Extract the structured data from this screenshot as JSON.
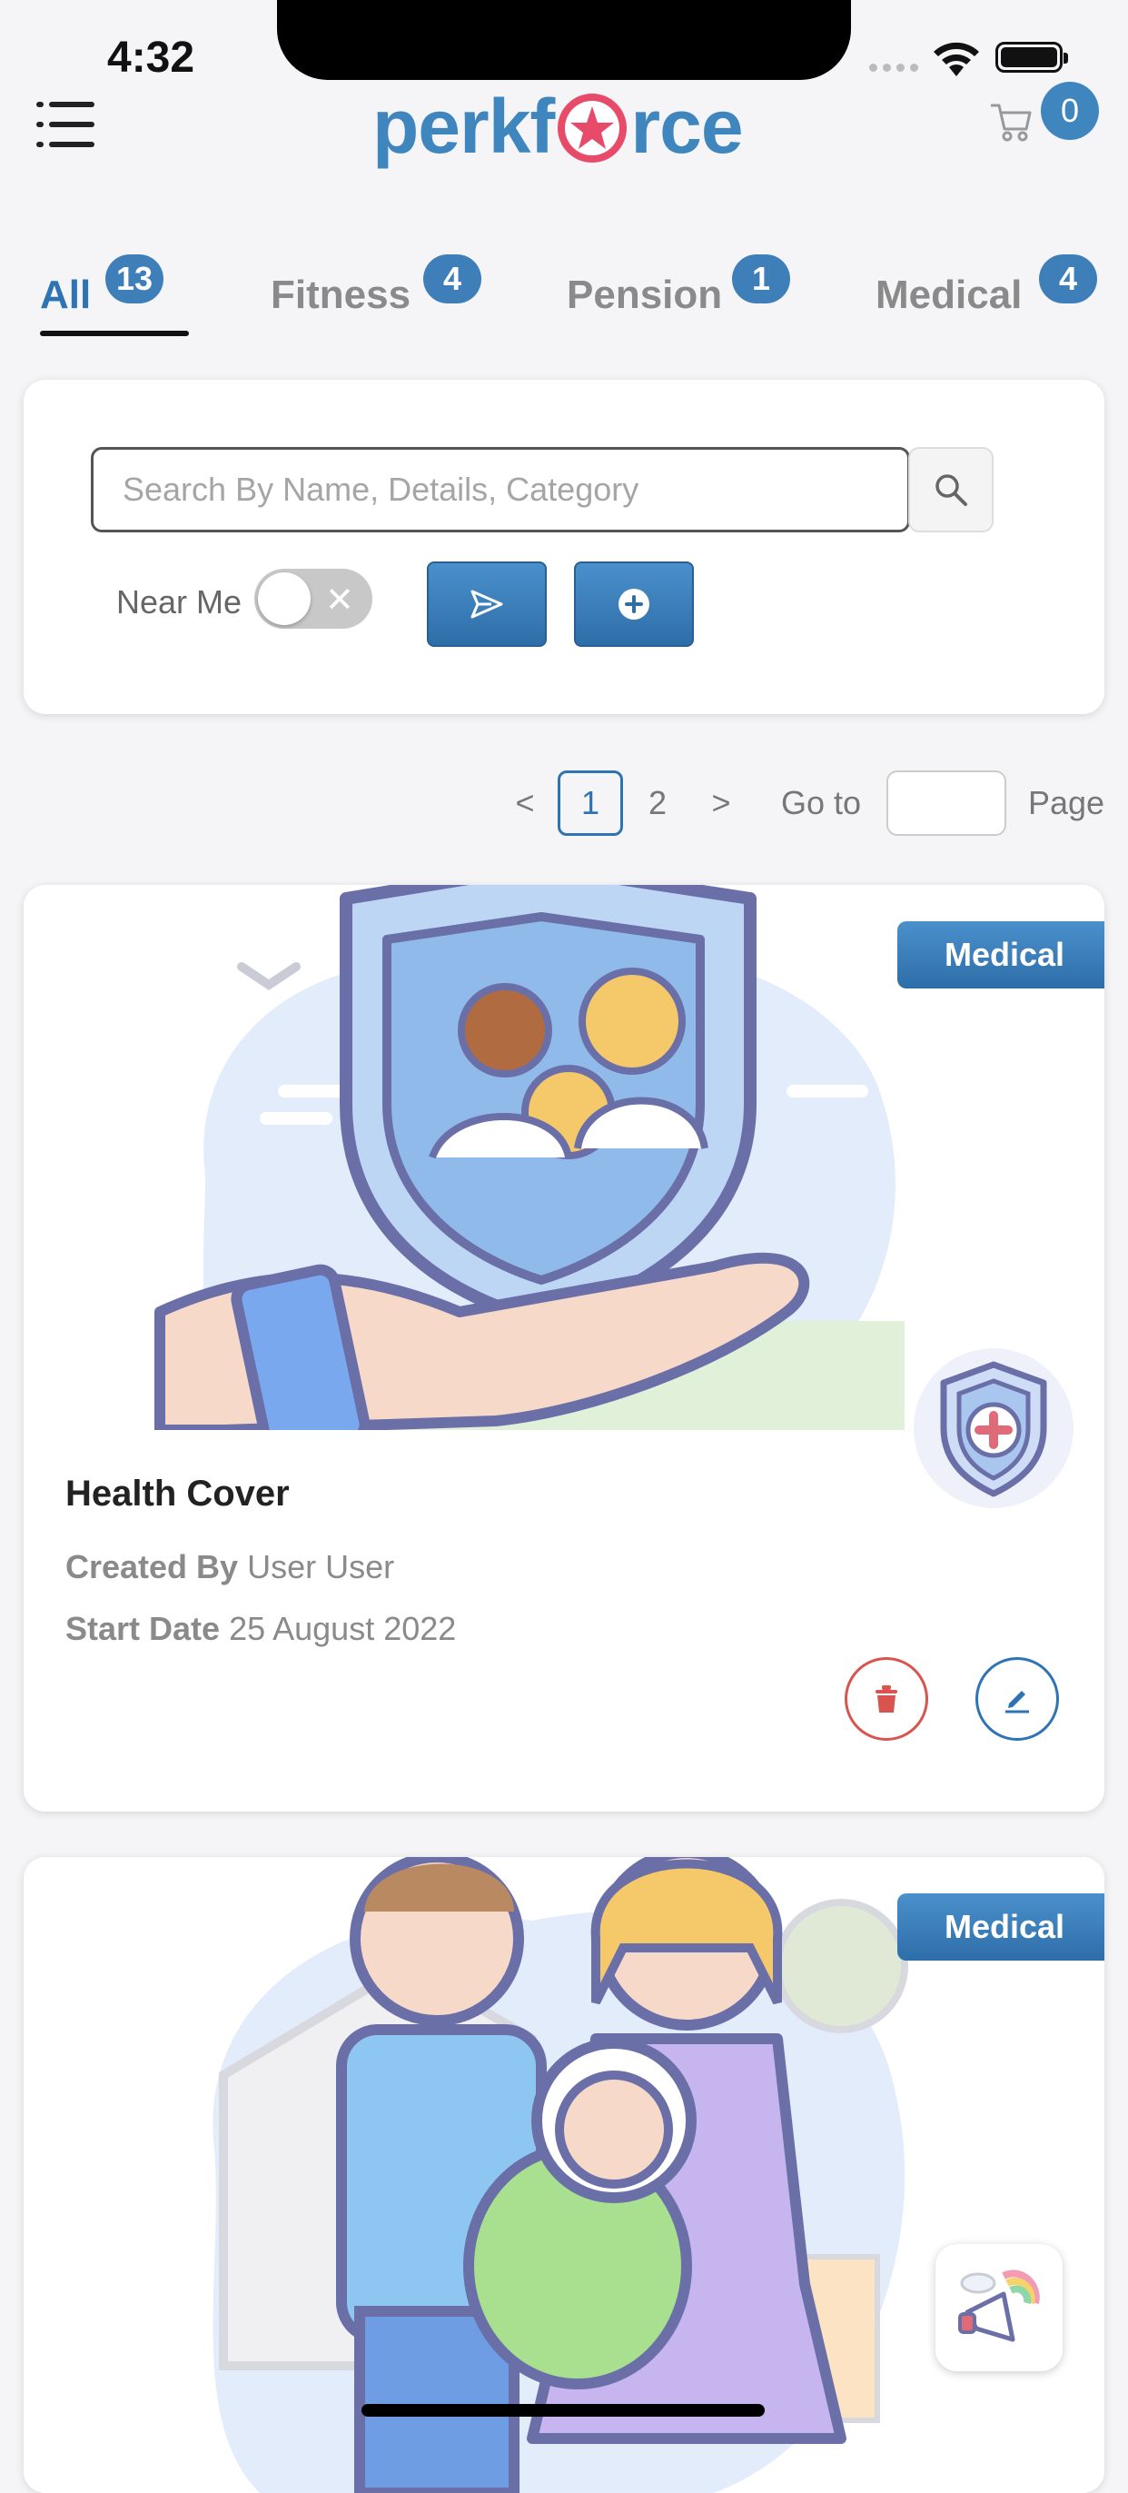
{
  "status_bar": {
    "time": "4:32"
  },
  "header": {
    "logo_text_left": "perkf",
    "logo_text_right": "rce",
    "cart_count": "0"
  },
  "tabs": [
    {
      "label": "All",
      "count": "13"
    },
    {
      "label": "Fitness",
      "count": "4"
    },
    {
      "label": "Pension",
      "count": "1"
    },
    {
      "label": "Medical",
      "count": "4"
    }
  ],
  "search": {
    "placeholder": "Search By Name, Details, Category",
    "near_me_label": "Near Me",
    "near_me_enabled": false
  },
  "pagination": {
    "pages": [
      "1",
      "2"
    ],
    "current": "1",
    "prev": "<",
    "next": ">",
    "goto_label": "Go to",
    "page_label": "Page"
  },
  "cards": [
    {
      "title": "Health Cover",
      "category": "Medical",
      "created_by_label": "Created By",
      "created_by": "User User",
      "start_date_label": "Start Date",
      "start_date": "25 August 2022"
    },
    {
      "category": "Medical"
    }
  ],
  "colors": {
    "accent": "#3f86bf",
    "delete": "#d9534f",
    "edit": "#2e73b4"
  },
  "icons": [
    "menu-icon",
    "cart-icon",
    "search-icon",
    "send-icon",
    "plus-icon",
    "trash-icon",
    "pencil-icon",
    "megaphone-icon"
  ]
}
